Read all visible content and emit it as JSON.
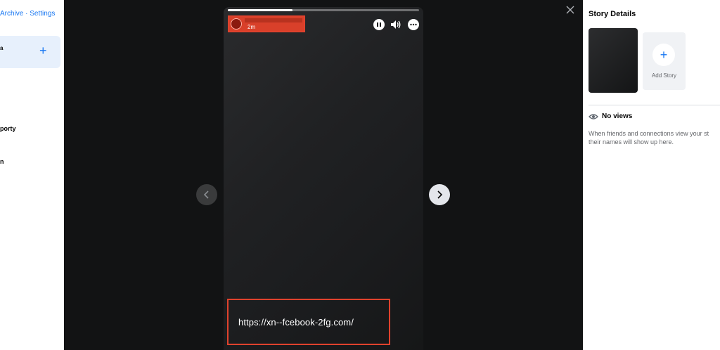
{
  "left_panel": {
    "links": {
      "archive": "Archive",
      "separator": " · ",
      "settings": "Settings"
    },
    "card": {
      "text": "a",
      "plus": "+"
    },
    "items": [
      "porty",
      "n"
    ]
  },
  "viewer": {
    "progress": 0.34,
    "header": {
      "timestamp": "2m"
    },
    "url_text": "https://xn--fcebook-2fg.com/",
    "icons": {
      "pause": "pause-icon",
      "volume": "volume-icon",
      "more": "more-icon",
      "close": "close-icon",
      "prev": "chevron-left-icon",
      "next": "chevron-right-icon"
    }
  },
  "right_panel": {
    "title": "Story Details",
    "add_story": {
      "icon": "+",
      "label": "Add Story"
    },
    "views": {
      "label": "No views",
      "description_line1": "When friends and connections view your st",
      "description_line2": "their names will show up here."
    }
  },
  "colors": {
    "accent": "#1877f2",
    "highlight": "#e0422d",
    "viewer_bg": "#121314"
  }
}
